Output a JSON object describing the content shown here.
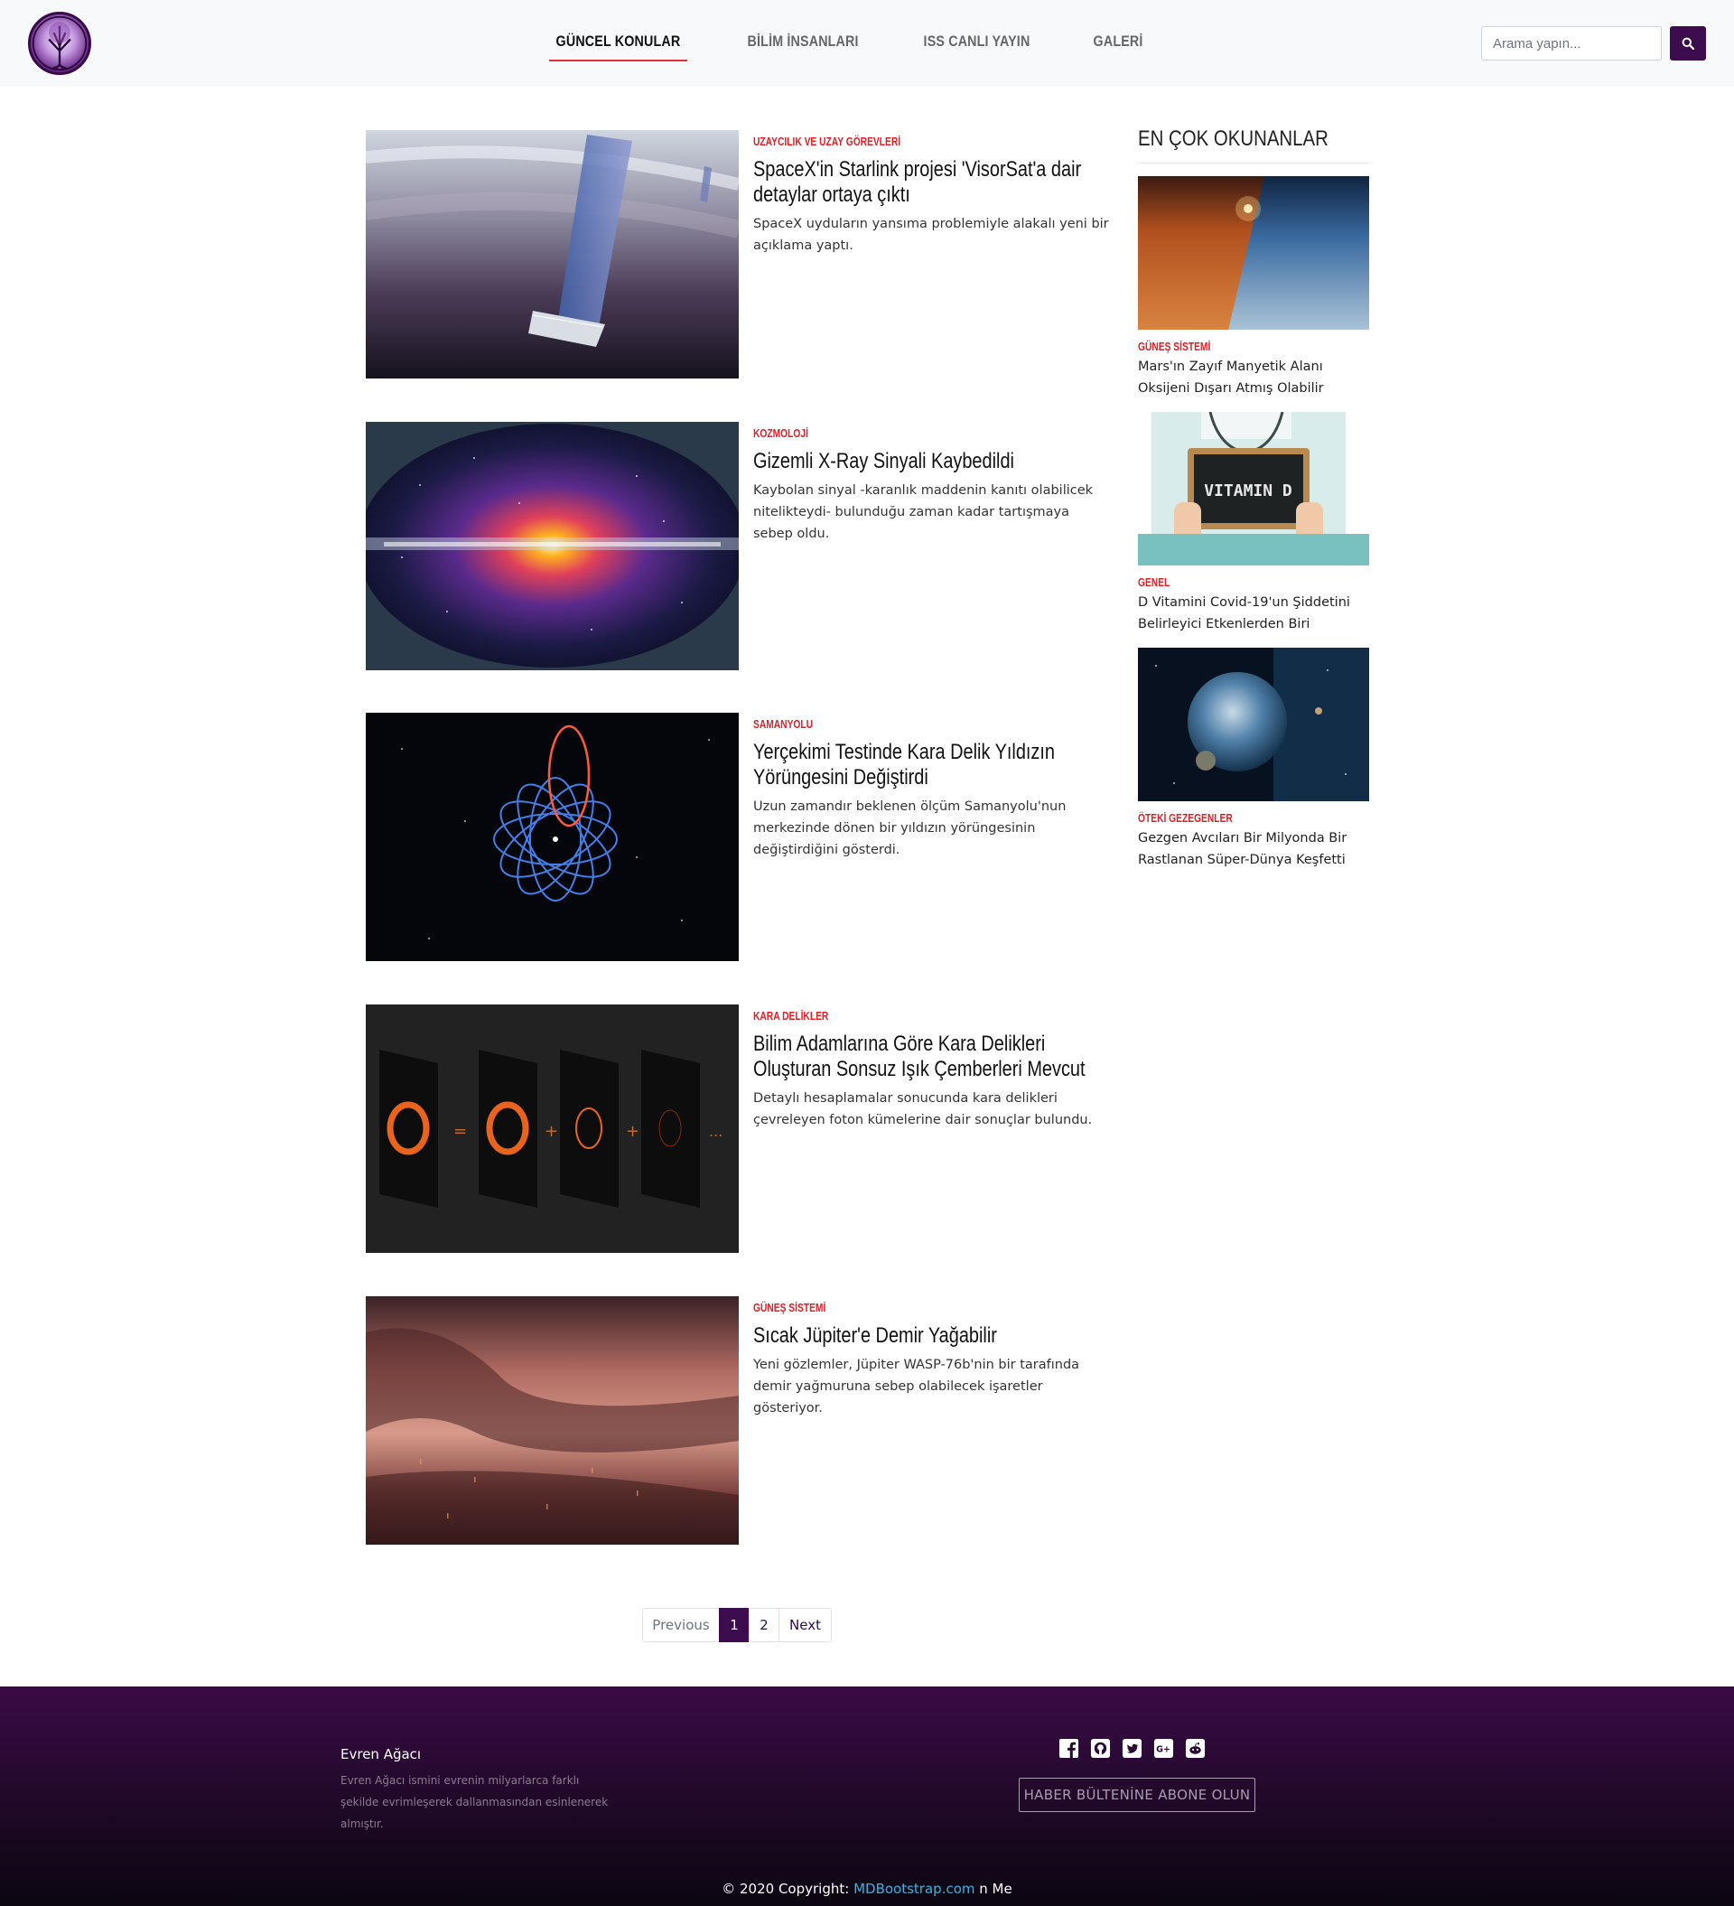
{
  "navbar": {
    "logo_icon": "tree-of-life-logo",
    "links": [
      {
        "label": "GÜNCEL KONULAR",
        "active": true
      },
      {
        "label": "BİLİM İNSANLARI",
        "active": false
      },
      {
        "label": "ISS CANLI YAYIN",
        "active": false
      },
      {
        "label": "GALERİ",
        "active": false
      }
    ],
    "search_placeholder": "Arama yapın...",
    "search_icon": "search-icon"
  },
  "articles": [
    {
      "category": "UZAYCILIK VE UZAY GÖREVLERİ",
      "title": "SpaceX'in Starlink projesi 'VisorSat'a dair detaylar ortaya çıktı",
      "description": "SpaceX uyduların yansıma problemiyle alakalı yeni bir açıklama yaptı.",
      "image_icon": "starlink-satellite-image"
    },
    {
      "category": "KOZMOLOJİ",
      "title": "Gizemli X-Ray Sinyali Kaybedildi",
      "description": "Kaybolan sinyal -karanlık maddenin kanıtı olabilicek nitelikteydi- bulunduğu zaman kadar tartışmaya sebep oldu.",
      "image_icon": "xray-galaxy-image"
    },
    {
      "category": "SAMANYOLU",
      "title": "Yerçekimi Testinde Kara Delik Yıldızın Yörüngesini Değiştirdi",
      "description": "Uzun zamandır beklenen ölçüm Samanyolu'nun merkezinde dönen bir yıldızın yörüngesinin değiştirdiğini gösterdi.",
      "image_icon": "star-orbit-image"
    },
    {
      "category": "KARA DELİKLER",
      "title": "Bilim Adamlarına Göre Kara Delikleri Oluşturan Sonsuz Işık Çemberleri Mevcut",
      "description": "Detaylı hesaplamalar sonucunda kara delikleri çevreleyen foton kümelerine dair sonuçlar bulundu.",
      "image_icon": "black-hole-rings-image"
    },
    {
      "category": "GÜNEŞ SİSTEMİ",
      "title": "Sıcak Jüpiter'e Demir Yağabilir",
      "description": "Yeni gözlemler, Jüpiter WASP-76b'nin bir tarafında demir yağmuruna sebep olabilecek işaretler gösteriyor.",
      "image_icon": "hot-jupiter-image"
    }
  ],
  "sidebar": {
    "heading": "EN ÇOK OKUNANLAR",
    "items": [
      {
        "category": "GÜNEŞ SİSTEMİ",
        "title": "Mars'ın Zayıf Manyetik Alanı Oksijeni Dışarı Atmış Olabilir",
        "image_icon": "mars-earth-image"
      },
      {
        "category": "GENEL",
        "title": "D Vitamini Covid-19'un Şiddetini Belirleyici Etkenlerden Biri",
        "image_icon": "vitamin-d-image",
        "image_text": "VITAMIN D"
      },
      {
        "category": "ÖTEKİ GEZEGENLER",
        "title": "Gezgen Avcıları Bir Milyonda Bir Rastlanan Süper-Dünya Keşfetti",
        "image_icon": "super-earth-image"
      }
    ]
  },
  "pagination": {
    "previous": "Previous",
    "pages": [
      "1",
      "2"
    ],
    "active_page": "1",
    "next": "Next"
  },
  "footer": {
    "brand": "Evren Ağacı",
    "text": "Evren Ağacı ismini evrenin milyarlarca farklı şekilde evrimleşerek dallanmasından esinlenerek almıştır.",
    "social_icons": [
      "facebook-icon",
      "github-icon",
      "twitter-icon",
      "google-plus-icon",
      "reddit-icon"
    ],
    "subscribe_label": "HABER BÜLTENİNE ABONE OLUN",
    "copyright_prefix": "© 2020 Copyright:",
    "copyright_link": "MDBootstrap.com",
    "copyright_suffix": "n Me"
  },
  "colors": {
    "accent": "#3d0c4f",
    "category_red": "#e01f27",
    "footer_top": "#3a0a47",
    "link_blue": "#33b5e5"
  }
}
